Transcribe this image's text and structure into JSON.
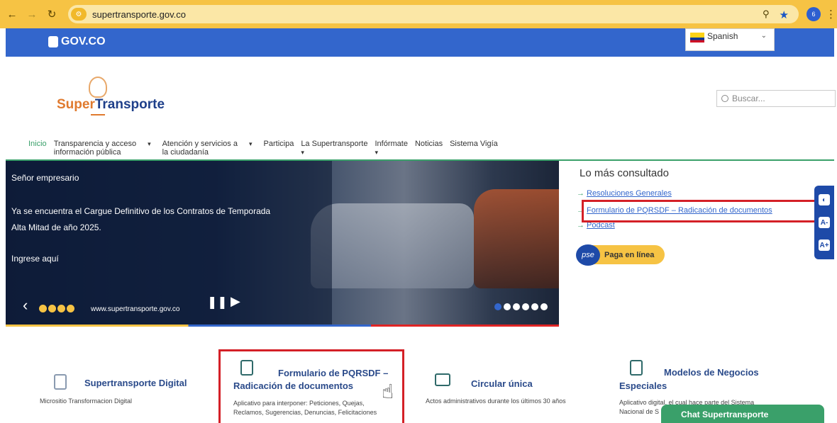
{
  "browser": {
    "url": "supertransporte.gov.co",
    "profile_initial": "6"
  },
  "gov_bar": {
    "logo": "GOV.CO",
    "language": "Spanish"
  },
  "header": {
    "logo_super": "Super",
    "logo_transporte": "Transporte",
    "search_placeholder": "Buscar..."
  },
  "menu": {
    "items": [
      {
        "line1": "Inicio",
        "line2": ""
      },
      {
        "line1": "Transparencia y acceso",
        "line2": "información pública"
      },
      {
        "line1": "Atención y servicios a",
        "line2": "la ciudadanía"
      },
      {
        "line1": "Participa",
        "line2": ""
      },
      {
        "line1": "La Supertransporte",
        "line2": ""
      },
      {
        "line1": "Infórmate",
        "line2": ""
      },
      {
        "line1": "Noticias",
        "line2": ""
      },
      {
        "line1": "Sistema Vigía",
        "line2": ""
      }
    ]
  },
  "hero": {
    "line1": "Señor empresario",
    "line2": "Ya se encuentra el Cargue Definitivo de los Contratos de Temporada",
    "line3": "Alta Mitad de año 2025.",
    "line4": "Ingrese aquí",
    "site_url": "www.supertransporte.gov.co",
    "slides": 6,
    "active_slide": 1
  },
  "most_consulted": {
    "title": "Lo más consultado",
    "links": [
      "Resoluciones Generales",
      "Formulario de PQRSDF – Radicación de documentos",
      "Podcast"
    ],
    "pse_badge": "pse",
    "pse_label": "Paga en línea"
  },
  "cards": [
    {
      "title": "Supertransporte Digital",
      "desc": "Micrositio Transformacion Digital"
    },
    {
      "title_line1": "Formulario de PQRSDF –",
      "title_line2": "Radicación de documentos",
      "desc_line1": "Aplicativo para interponer: Peticiones, Quejas,",
      "desc_line2": "Reclamos, Sugerencias, Denuncias, Felicitaciones"
    },
    {
      "title": "Circular única",
      "desc": "Actos administrativos durante los últimos 30 años"
    },
    {
      "title_line1": "Modelos de Negocios",
      "title_line2": "Especiales",
      "desc_line1": "Aplicativo digital, el cual hace parte del Sistema",
      "desc_line2": "Nacional de S"
    }
  ],
  "chat": {
    "label": "Chat Supertransporte"
  },
  "accessibility": [
    "contrast",
    "A-",
    "A+"
  ],
  "colors": {
    "browser_bar": "#f6c344",
    "gov_bar": "#3366cc",
    "highlight_box": "#d42027",
    "accent_green": "#3aa06a",
    "link_blue": "#3366cc"
  }
}
